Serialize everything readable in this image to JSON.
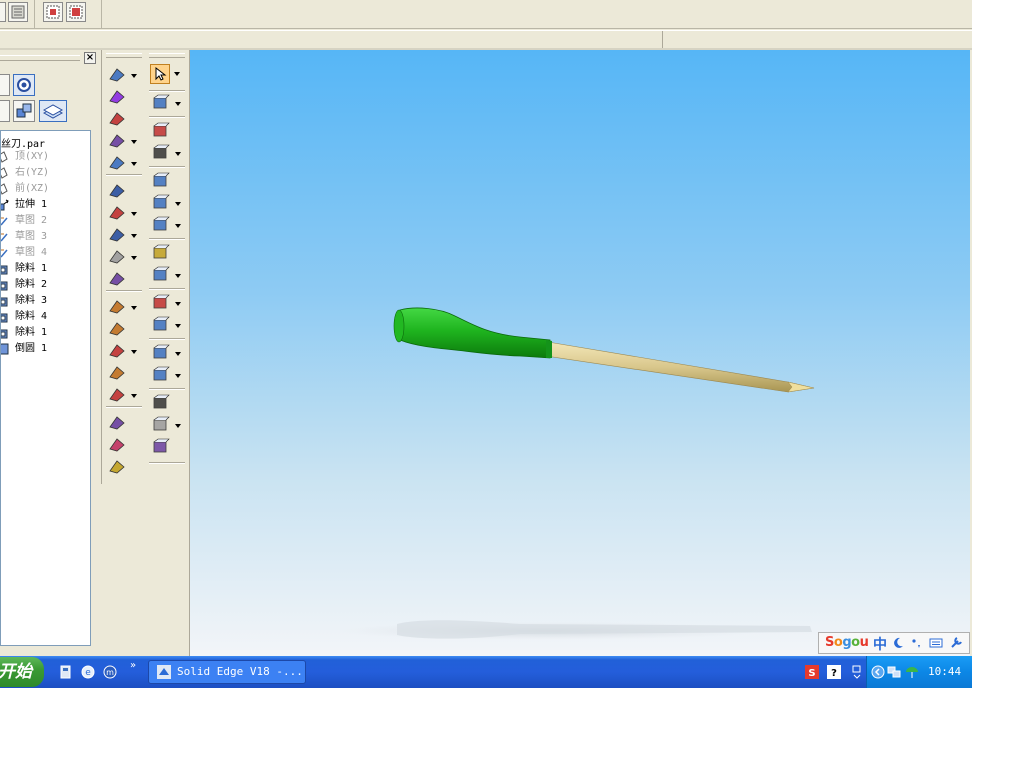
{
  "app": {
    "title": "Solid Edge V18",
    "accent_color": "#245edb"
  },
  "pathfinder": {
    "close_label": "×",
    "root": "丝刀.par",
    "items": [
      {
        "label": "顶(XY)",
        "icon": "plane-icon",
        "dim": true
      },
      {
        "label": "右(YZ)",
        "icon": "plane-icon",
        "dim": true
      },
      {
        "label": "前(XZ)",
        "icon": "plane-icon",
        "dim": true
      },
      {
        "label": "拉伸 1",
        "icon": "extrude-icon",
        "dim": false
      },
      {
        "label": "草图 2",
        "icon": "sketch-icon",
        "dim": true
      },
      {
        "label": "草图 3",
        "icon": "sketch-icon",
        "dim": true
      },
      {
        "label": "草图 4",
        "icon": "sketch-icon",
        "dim": true
      },
      {
        "label": "除料 1",
        "icon": "cutout-icon",
        "dim": false
      },
      {
        "label": "除料 2",
        "icon": "cutout-icon",
        "dim": false
      },
      {
        "label": "除料 3",
        "icon": "cutout-icon",
        "dim": false
      },
      {
        "label": "除料 4",
        "icon": "cutout-icon",
        "dim": false
      },
      {
        "label": "除料 1",
        "icon": "cutout-icon",
        "dim": false
      },
      {
        "label": "倒圆 1",
        "icon": "round-icon",
        "dim": false
      }
    ]
  },
  "ime": {
    "logo": "Sogou",
    "mode": "中"
  },
  "taskbar": {
    "start_label": "开始",
    "chevron": "»",
    "task_label": "Solid Edge V18 -...",
    "clock": "10:44"
  }
}
